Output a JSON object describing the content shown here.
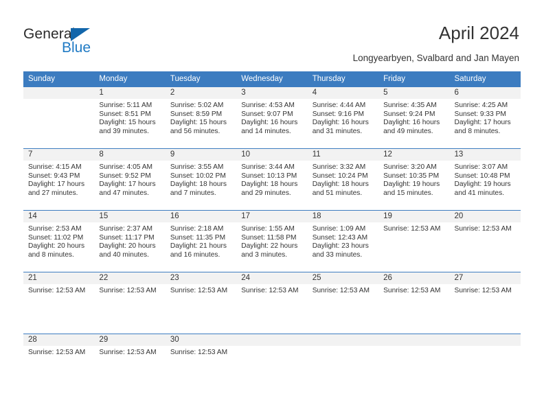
{
  "brand": {
    "name_part1": "General",
    "name_part2": "Blue",
    "triangle_icon": "logo-triangle-icon",
    "colors": {
      "dark": "#2b2b2b",
      "blue": "#1f7ac4",
      "triangle": "#1266ab"
    }
  },
  "header": {
    "month_title": "April 2024",
    "location": "Longyearbyen, Svalbard and Jan Mayen"
  },
  "theme": {
    "header_row_bg": "#3c7cc0",
    "header_row_text": "#ffffff",
    "daynum_band_bg": "#f2f2f2",
    "body_text": "#333333",
    "row_divider": "#3c7cc0"
  },
  "calendar": {
    "weekday_headers": [
      "Sunday",
      "Monday",
      "Tuesday",
      "Wednesday",
      "Thursday",
      "Friday",
      "Saturday"
    ],
    "weeks": [
      [
        {
          "day": "",
          "lines": []
        },
        {
          "day": "1",
          "lines": [
            "Sunrise: 5:11 AM",
            "Sunset: 8:51 PM",
            "Daylight: 15 hours",
            "and 39 minutes."
          ]
        },
        {
          "day": "2",
          "lines": [
            "Sunrise: 5:02 AM",
            "Sunset: 8:59 PM",
            "Daylight: 15 hours",
            "and 56 minutes."
          ]
        },
        {
          "day": "3",
          "lines": [
            "Sunrise: 4:53 AM",
            "Sunset: 9:07 PM",
            "Daylight: 16 hours",
            "and 14 minutes."
          ]
        },
        {
          "day": "4",
          "lines": [
            "Sunrise: 4:44 AM",
            "Sunset: 9:16 PM",
            "Daylight: 16 hours",
            "and 31 minutes."
          ]
        },
        {
          "day": "5",
          "lines": [
            "Sunrise: 4:35 AM",
            "Sunset: 9:24 PM",
            "Daylight: 16 hours",
            "and 49 minutes."
          ]
        },
        {
          "day": "6",
          "lines": [
            "Sunrise: 4:25 AM",
            "Sunset: 9:33 PM",
            "Daylight: 17 hours",
            "and 8 minutes."
          ]
        }
      ],
      [
        {
          "day": "7",
          "lines": [
            "Sunrise: 4:15 AM",
            "Sunset: 9:43 PM",
            "Daylight: 17 hours",
            "and 27 minutes."
          ]
        },
        {
          "day": "8",
          "lines": [
            "Sunrise: 4:05 AM",
            "Sunset: 9:52 PM",
            "Daylight: 17 hours",
            "and 47 minutes."
          ]
        },
        {
          "day": "9",
          "lines": [
            "Sunrise: 3:55 AM",
            "Sunset: 10:02 PM",
            "Daylight: 18 hours",
            "and 7 minutes."
          ]
        },
        {
          "day": "10",
          "lines": [
            "Sunrise: 3:44 AM",
            "Sunset: 10:13 PM",
            "Daylight: 18 hours",
            "and 29 minutes."
          ]
        },
        {
          "day": "11",
          "lines": [
            "Sunrise: 3:32 AM",
            "Sunset: 10:24 PM",
            "Daylight: 18 hours",
            "and 51 minutes."
          ]
        },
        {
          "day": "12",
          "lines": [
            "Sunrise: 3:20 AM",
            "Sunset: 10:35 PM",
            "Daylight: 19 hours",
            "and 15 minutes."
          ]
        },
        {
          "day": "13",
          "lines": [
            "Sunrise: 3:07 AM",
            "Sunset: 10:48 PM",
            "Daylight: 19 hours",
            "and 41 minutes."
          ]
        }
      ],
      [
        {
          "day": "14",
          "lines": [
            "Sunrise: 2:53 AM",
            "Sunset: 11:02 PM",
            "Daylight: 20 hours",
            "and 8 minutes."
          ]
        },
        {
          "day": "15",
          "lines": [
            "Sunrise: 2:37 AM",
            "Sunset: 11:17 PM",
            "Daylight: 20 hours",
            "and 40 minutes."
          ]
        },
        {
          "day": "16",
          "lines": [
            "Sunrise: 2:18 AM",
            "Sunset: 11:35 PM",
            "Daylight: 21 hours",
            "and 16 minutes."
          ]
        },
        {
          "day": "17",
          "lines": [
            "Sunrise: 1:55 AM",
            "Sunset: 11:58 PM",
            "Daylight: 22 hours",
            "and 3 minutes."
          ]
        },
        {
          "day": "18",
          "lines": [
            "Sunrise: 1:09 AM",
            "Sunset: 12:43 AM",
            "Daylight: 23 hours",
            "and 33 minutes."
          ]
        },
        {
          "day": "19",
          "lines": [
            "Sunrise: 12:53 AM"
          ]
        },
        {
          "day": "20",
          "lines": [
            "Sunrise: 12:53 AM"
          ]
        }
      ],
      [
        {
          "day": "21",
          "lines": [
            "Sunrise: 12:53 AM"
          ]
        },
        {
          "day": "22",
          "lines": [
            "Sunrise: 12:53 AM"
          ]
        },
        {
          "day": "23",
          "lines": [
            "Sunrise: 12:53 AM"
          ]
        },
        {
          "day": "24",
          "lines": [
            "Sunrise: 12:53 AM"
          ]
        },
        {
          "day": "25",
          "lines": [
            "Sunrise: 12:53 AM"
          ]
        },
        {
          "day": "26",
          "lines": [
            "Sunrise: 12:53 AM"
          ]
        },
        {
          "day": "27",
          "lines": [
            "Sunrise: 12:53 AM"
          ]
        }
      ],
      [
        {
          "day": "28",
          "lines": [
            "Sunrise: 12:53 AM"
          ]
        },
        {
          "day": "29",
          "lines": [
            "Sunrise: 12:53 AM"
          ]
        },
        {
          "day": "30",
          "lines": [
            "Sunrise: 12:53 AM"
          ]
        },
        {
          "day": "",
          "lines": []
        },
        {
          "day": "",
          "lines": []
        },
        {
          "day": "",
          "lines": []
        },
        {
          "day": "",
          "lines": []
        }
      ]
    ]
  }
}
